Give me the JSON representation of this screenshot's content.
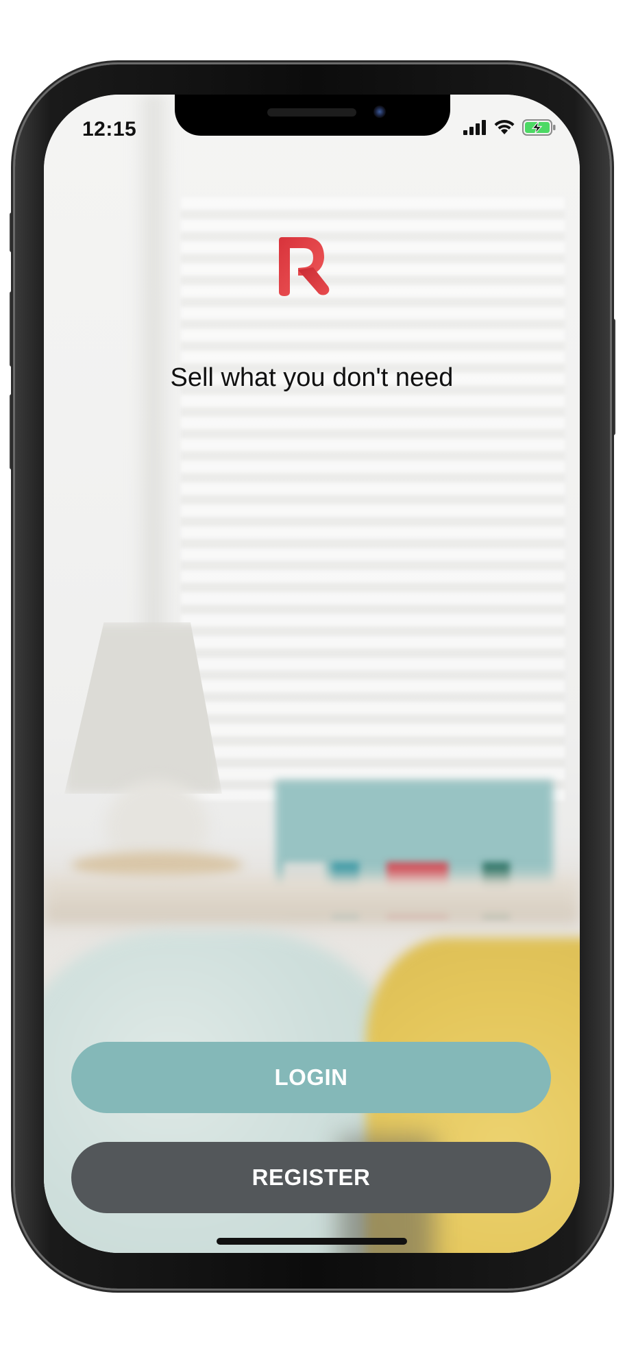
{
  "status_bar": {
    "time": "12:15",
    "icons": [
      "cellular-signal-icon",
      "wifi-icon",
      "battery-charging-icon"
    ]
  },
  "app": {
    "logo_icon": "r-logo-icon",
    "tagline": "Sell what you don't need",
    "brand_color": "#e04848"
  },
  "buttons": {
    "login_label": "LOGIN",
    "login_color": "#84b8b8",
    "register_label": "REGISTER",
    "register_color": "#53575a"
  }
}
